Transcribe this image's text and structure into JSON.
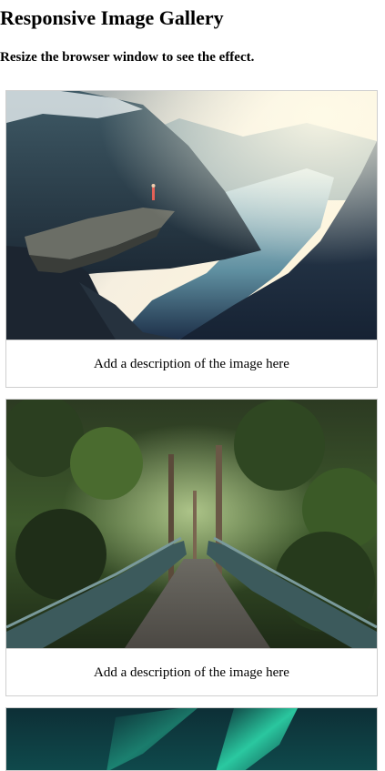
{
  "page": {
    "title": "Responsive Image Gallery",
    "subtitle": "Resize the browser window to see the effect."
  },
  "gallery": {
    "items": [
      {
        "image": "mountain-fjord-image",
        "description": "Add a description of the image here"
      },
      {
        "image": "forest-bridge-image",
        "description": "Add a description of the image here"
      },
      {
        "image": "northern-lights-image",
        "description": ""
      }
    ]
  }
}
